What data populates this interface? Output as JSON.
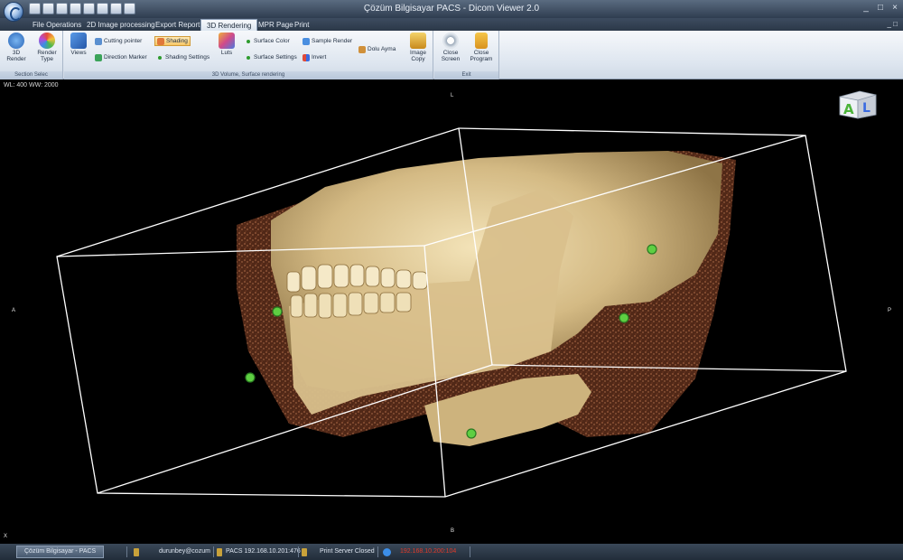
{
  "window": {
    "title": "Çözüm Bilgisayar PACS - Dicom Viewer 2.0",
    "controls": [
      "_",
      "□",
      "×"
    ]
  },
  "tabs": [
    {
      "label": "File Operations",
      "active": false
    },
    {
      "label": "2D Image processing",
      "active": false
    },
    {
      "label": "Export Report",
      "active": false
    },
    {
      "label": "3D Rendering",
      "active": true
    },
    {
      "label": "MPR Page",
      "active": false
    },
    {
      "label": "Print",
      "active": false
    }
  ],
  "tabbar_right": "_ □",
  "ribbon": {
    "groups": [
      {
        "label": "Section Selec"
      },
      {
        "label": "3D Volume, Surface rendering"
      },
      {
        "label": "Exit"
      }
    ],
    "buttons": {
      "render3d": "3D Render",
      "render_type": "Render Type",
      "views": "Views",
      "cutting_pointer": "Cutting pointer",
      "direction_marker": "Direction Marker",
      "shading": "Shading",
      "shading_settings": "Shading Settings",
      "luts": "Luts",
      "surface_color": "Surface Color",
      "surface_settings": "Surface Settings",
      "sample_render": "Sample Render",
      "invert": "Invert",
      "dolu_ayma": "Dolu Ayma",
      "image_copy": "Image Copy",
      "close_screen": "Close Screen",
      "close_program": "Close Program"
    }
  },
  "viewport": {
    "wlww": "WL: 400 WW: 2000",
    "orient_top": "L",
    "orient_left": "A",
    "orient_right": "P",
    "orient_bottom": "B",
    "corner_bottom_left": "X",
    "cube_letters": [
      "A",
      "L"
    ]
  },
  "status": {
    "task_button": "Çözüm Bilgisayar - PACS",
    "user": "durunbey@cozum",
    "pacs": "PACS 192.168.10.201:476",
    "print": "Print Server Closed",
    "alert": "192.168.10.200:104"
  },
  "colors": {
    "viewport_bg": "#000000",
    "bone": "#d8c08a",
    "tissue": "#8a4a2e",
    "marker": "#5ecf42",
    "box_lines": "#ffffff",
    "alert_text": "#e03a2a"
  }
}
